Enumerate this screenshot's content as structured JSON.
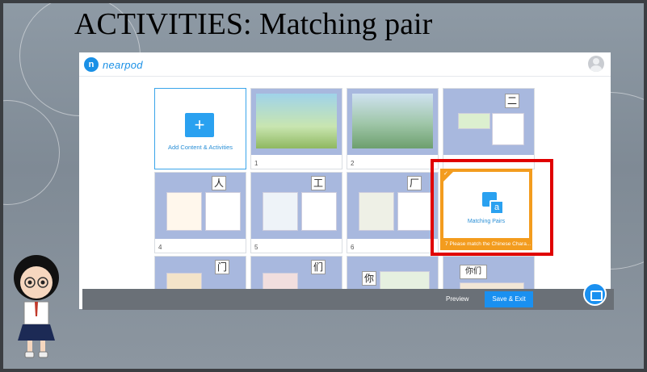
{
  "slide": {
    "title": "ACTIVITIES: Matching pair"
  },
  "brand": {
    "logo_text": "nearpod",
    "accent": "#1a90e6"
  },
  "add_card": {
    "label": "Add Content & Activities",
    "icon": "plus-folder-icon"
  },
  "slides": [
    {
      "number": "1",
      "kind": "scene-school"
    },
    {
      "number": "2",
      "kind": "scene-market"
    },
    {
      "number": "",
      "kind": "char-er",
      "char": "二"
    },
    {
      "number": "4",
      "kind": "char-ren",
      "char": "人"
    },
    {
      "number": "5",
      "kind": "char-gong",
      "char": "工"
    },
    {
      "number": "6",
      "kind": "char-chang",
      "char": "厂"
    },
    {
      "number": "",
      "kind": "char-men",
      "char": "门"
    },
    {
      "number": "",
      "kind": "char-men2",
      "char": "们"
    },
    {
      "number": "",
      "kind": "char-ni",
      "char": "你"
    },
    {
      "number": "",
      "kind": "char-nimen",
      "char": "你们"
    }
  ],
  "matching_pairs": {
    "number": "7",
    "label": "Matching Pairs",
    "caption": "Please match the Chinese Chara..."
  },
  "footer": {
    "preview_label": "Preview",
    "save_label": "Save & Exit"
  }
}
